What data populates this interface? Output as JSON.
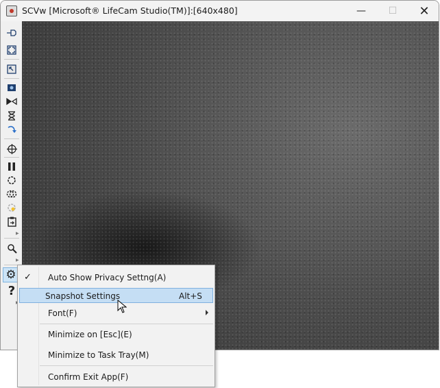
{
  "window": {
    "title": "SCVw [Microsoft® LifeCam Studio(TM)]:[640x480]",
    "min_glyph": "—",
    "max_glyph": "☐",
    "close_glyph": "✕"
  },
  "toolbar": {
    "icons": [
      "pin-icon",
      "fit-window-icon",
      "resize-icon",
      "camera-icon",
      "flip-icon",
      "timer-icon",
      "rotate-icon",
      "crosshair-icon",
      "pause-icon",
      "snapshot-icon",
      "continuous-snapshot-icon",
      "color-icon",
      "clipboard-icon",
      "zoom-icon",
      "gear-icon",
      "help-icon"
    ],
    "help_glyph": "?",
    "gear_glyph": "⚙"
  },
  "context_menu": {
    "items": [
      {
        "label": "Auto Show Privacy Settng(A)",
        "checked": true
      },
      {
        "label": "Snapshot Settings",
        "shortcut": "Alt+S",
        "highlighted": true
      },
      {
        "label": "Font(F)",
        "submenu": true
      },
      {
        "label": "Minimize on [Esc](E)"
      },
      {
        "label": "Minimize to Task Tray(M)"
      },
      {
        "label": "Confirm Exit App(F)"
      }
    ],
    "check_glyph": "✓"
  },
  "colors": {
    "highlight": "#c5def4",
    "highlight_border": "#7fb0de",
    "toolbar_icon": "#1f3f6e"
  }
}
